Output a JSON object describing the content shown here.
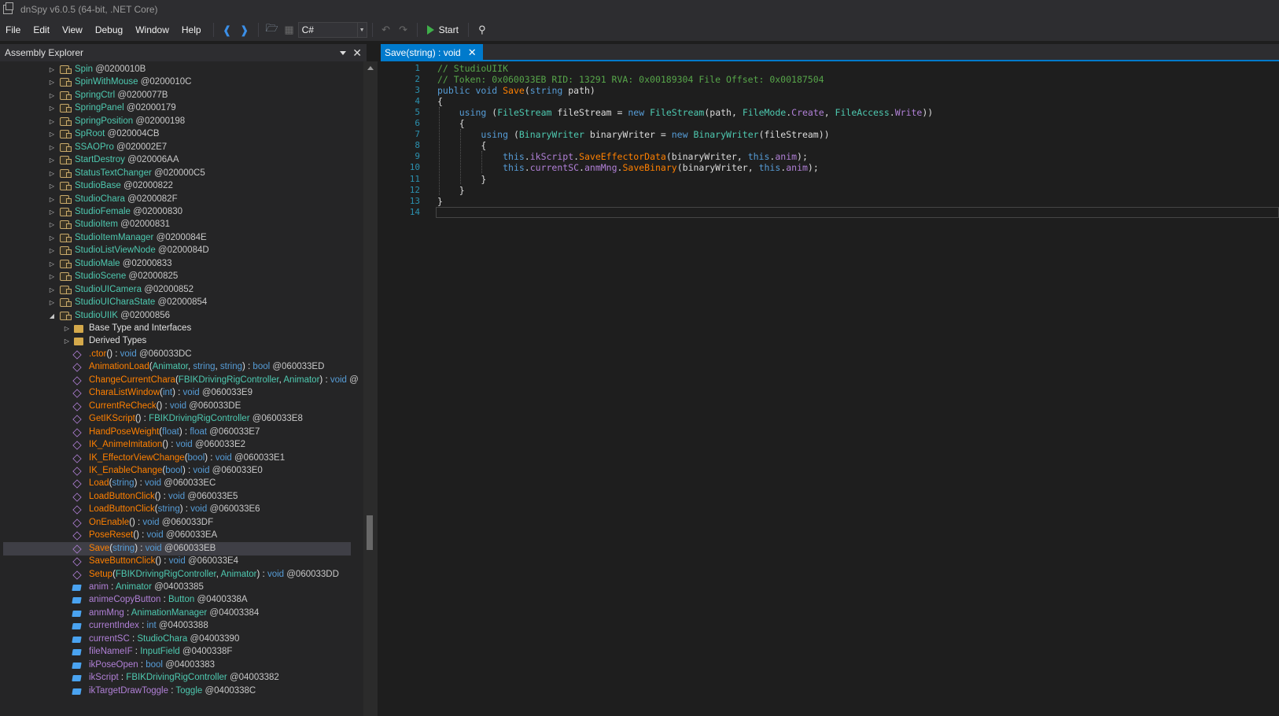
{
  "window": {
    "title": "dnSpy v6.0.5 (64-bit, .NET Core)"
  },
  "menu": [
    "File",
    "Edit",
    "View",
    "Debug",
    "Window",
    "Help"
  ],
  "toolbar": {
    "language": "C#",
    "start_label": "Start"
  },
  "explorer": {
    "title": "Assembly Explorer"
  },
  "types": [
    {
      "name": "Spin",
      "token": "@0200010B"
    },
    {
      "name": "SpinWithMouse",
      "token": "@0200010C"
    },
    {
      "name": "SpringCtrl",
      "token": "@0200077B"
    },
    {
      "name": "SpringPanel",
      "token": "@02000179"
    },
    {
      "name": "SpringPosition",
      "token": "@02000198"
    },
    {
      "name": "SpRoot",
      "token": "@020004CB"
    },
    {
      "name": "SSAOPro",
      "token": "@020002E7"
    },
    {
      "name": "StartDestroy",
      "token": "@020006AA"
    },
    {
      "name": "StatusTextChanger",
      "token": "@020000C5"
    },
    {
      "name": "StudioBase",
      "token": "@02000822"
    },
    {
      "name": "StudioChara",
      "token": "@0200082F"
    },
    {
      "name": "StudioFemale",
      "token": "@02000830"
    },
    {
      "name": "StudioItem",
      "token": "@02000831"
    },
    {
      "name": "StudioItemManager",
      "token": "@0200084E"
    },
    {
      "name": "StudioListViewNode",
      "token": "@0200084D"
    },
    {
      "name": "StudioMale",
      "token": "@02000833"
    },
    {
      "name": "StudioScene",
      "token": "@02000825"
    },
    {
      "name": "StudioUICamera",
      "token": "@02000852"
    },
    {
      "name": "StudioUICharaState",
      "token": "@02000854"
    },
    {
      "name": "StudioUIIK",
      "token": "@02000856"
    }
  ],
  "folders": [
    "Base Type and Interfaces",
    "Derived Types"
  ],
  "methods": [
    {
      "name": ".ctor",
      "params": [],
      "ret": "void",
      "token": "@060033DC"
    },
    {
      "name": "AnimationLoad",
      "params": [
        [
          "Animator",
          "c"
        ],
        [
          "string",
          "k"
        ],
        [
          "string",
          "k"
        ]
      ],
      "ret": "bool",
      "token": "@060033ED"
    },
    {
      "name": "ChangeCurrentChara",
      "params": [
        [
          "FBIKDrivingRigController",
          "c"
        ],
        [
          "Animator",
          "c"
        ]
      ],
      "ret": "void",
      "token": "@"
    },
    {
      "name": "CharaListWindow",
      "params": [
        [
          "int",
          "k"
        ]
      ],
      "ret": "void",
      "token": "@060033E9"
    },
    {
      "name": "CurrentReCheck",
      "params": [],
      "ret": "void",
      "token": "@060033DE"
    },
    {
      "name": "GetIKScript",
      "params": [],
      "ret": "FBIKDrivingRigController",
      "token": "@060033E8"
    },
    {
      "name": "HandPoseWeight",
      "params": [
        [
          "float",
          "k"
        ]
      ],
      "ret": "float",
      "token": "@060033E7"
    },
    {
      "name": "IK_AnimeImitation",
      "params": [],
      "ret": "void",
      "token": "@060033E2"
    },
    {
      "name": "IK_EffectorViewChange",
      "params": [
        [
          "bool",
          "k"
        ]
      ],
      "ret": "void",
      "token": "@060033E1"
    },
    {
      "name": "IK_EnableChange",
      "params": [
        [
          "bool",
          "k"
        ]
      ],
      "ret": "void",
      "token": "@060033E0"
    },
    {
      "name": "Load",
      "params": [
        [
          "string",
          "k"
        ]
      ],
      "ret": "void",
      "token": "@060033EC"
    },
    {
      "name": "LoadButtonClick",
      "params": [],
      "ret": "void",
      "token": "@060033E5"
    },
    {
      "name": "LoadButtonClick",
      "params": [
        [
          "string",
          "k"
        ]
      ],
      "ret": "void",
      "token": "@060033E6"
    },
    {
      "name": "OnEnable",
      "params": [],
      "ret": "void",
      "token": "@060033DF"
    },
    {
      "name": "PoseReset",
      "params": [],
      "ret": "void",
      "token": "@060033EA"
    },
    {
      "name": "Save",
      "params": [
        [
          "string",
          "k"
        ]
      ],
      "ret": "void",
      "token": "@060033EB",
      "selected": true
    },
    {
      "name": "SaveButtonClick",
      "params": [],
      "ret": "void",
      "token": "@060033E4"
    },
    {
      "name": "Setup",
      "params": [
        [
          "FBIKDrivingRigController",
          "c"
        ],
        [
          "Animator",
          "c"
        ]
      ],
      "ret": "void",
      "token": "@060033DD"
    }
  ],
  "fields": [
    {
      "name": "anim",
      "type": "Animator",
      "kw": false,
      "token": "@04003385"
    },
    {
      "name": "animeCopyButton",
      "type": "Button",
      "kw": false,
      "token": "@0400338A"
    },
    {
      "name": "anmMng",
      "type": "AnimationManager",
      "kw": false,
      "token": "@04003384"
    },
    {
      "name": "currentIndex",
      "type": "int",
      "kw": true,
      "token": "@04003388"
    },
    {
      "name": "currentSC",
      "type": "StudioChara",
      "kw": false,
      "token": "@04003390"
    },
    {
      "name": "fileNameIF",
      "type": "InputField",
      "kw": false,
      "token": "@0400338F"
    },
    {
      "name": "ikPoseOpen",
      "type": "bool",
      "kw": true,
      "token": "@04003383"
    },
    {
      "name": "ikScript",
      "type": "FBIKDrivingRigController",
      "kw": false,
      "token": "@04003382"
    },
    {
      "name": "ikTargetDrawToggle",
      "type": "Toggle",
      "kw": false,
      "token": "@0400338C"
    }
  ],
  "editor": {
    "tab_label": "Save(string) : void",
    "lines": [
      [
        [
          "// StudioUIIK",
          "cm"
        ]
      ],
      [
        [
          "// Token: 0x060033EB RID: 13291 RVA: 0x00189304 File Offset: 0x00187504",
          "cm"
        ]
      ],
      [
        [
          "public",
          "k"
        ],
        [
          " ",
          ""
        ],
        [
          "void",
          "k"
        ],
        [
          " ",
          ""
        ],
        [
          "Save",
          "m"
        ],
        [
          "(",
          ""
        ],
        [
          "string",
          "k"
        ],
        [
          " path)",
          ""
        ]
      ],
      [
        [
          "{",
          ""
        ]
      ],
      [
        [
          "    ",
          ""
        ],
        [
          "using",
          "k"
        ],
        [
          " (",
          ""
        ],
        [
          "FileStream",
          "t"
        ],
        [
          " fileStream = ",
          ""
        ],
        [
          "new",
          "k"
        ],
        [
          " ",
          ""
        ],
        [
          "FileStream",
          "t"
        ],
        [
          "(path, ",
          ""
        ],
        [
          "FileMode",
          "t"
        ],
        [
          ".",
          ""
        ],
        [
          "Create",
          "e"
        ],
        [
          ", ",
          ""
        ],
        [
          "FileAccess",
          "t"
        ],
        [
          ".",
          ""
        ],
        [
          "Write",
          "e"
        ],
        [
          "))",
          ""
        ]
      ],
      [
        [
          "    {",
          ""
        ]
      ],
      [
        [
          "        ",
          ""
        ],
        [
          "using",
          "k"
        ],
        [
          " (",
          ""
        ],
        [
          "BinaryWriter",
          "t"
        ],
        [
          " binaryWriter = ",
          ""
        ],
        [
          "new",
          "k"
        ],
        [
          " ",
          ""
        ],
        [
          "BinaryWriter",
          "t"
        ],
        [
          "(fileStream))",
          ""
        ]
      ],
      [
        [
          "        {",
          ""
        ]
      ],
      [
        [
          "            ",
          ""
        ],
        [
          "this",
          "k"
        ],
        [
          ".",
          ""
        ],
        [
          "ikScript",
          "f"
        ],
        [
          ".",
          ""
        ],
        [
          "SaveEffectorData",
          "m"
        ],
        [
          "(binaryWriter, ",
          ""
        ],
        [
          "this",
          "k"
        ],
        [
          ".",
          ""
        ],
        [
          "anim",
          "f"
        ],
        [
          ");",
          ""
        ]
      ],
      [
        [
          "            ",
          ""
        ],
        [
          "this",
          "k"
        ],
        [
          ".",
          ""
        ],
        [
          "currentSC",
          "f"
        ],
        [
          ".",
          ""
        ],
        [
          "anmMng",
          "f"
        ],
        [
          ".",
          ""
        ],
        [
          "SaveBinary",
          "m"
        ],
        [
          "(binaryWriter, ",
          ""
        ],
        [
          "this",
          "k"
        ],
        [
          ".",
          ""
        ],
        [
          "anim",
          "f"
        ],
        [
          ");",
          ""
        ]
      ],
      [
        [
          "        }",
          ""
        ]
      ],
      [
        [
          "    }",
          ""
        ]
      ],
      [
        [
          "}",
          ""
        ]
      ],
      [
        [
          "",
          ""
        ]
      ]
    ]
  },
  "colors": {
    "accent": "#007acc",
    "background": "#1e1e1e",
    "panel": "#252526"
  }
}
